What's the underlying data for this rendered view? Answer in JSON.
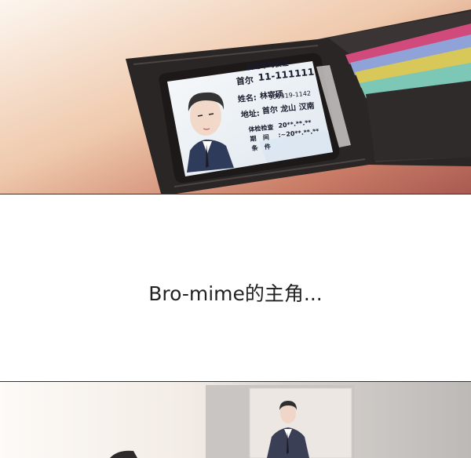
{
  "id_card": {
    "header": "机动车驾驶证",
    "city": "首尔",
    "number": "11-111111",
    "name_label": "姓名:",
    "name": "林宰硕",
    "id_no": "900319-1142",
    "addr_label": "地址:",
    "address": "首尔 龙山 汉南",
    "exam_label": "体检检查",
    "exam_value": "20**.**.**",
    "period_label1": "期",
    "period_label2": "间",
    "period_value": ":~20**.**.**",
    "cond_label1": "条",
    "cond_label2": "件"
  },
  "caption": "Bro-mime的主角..."
}
